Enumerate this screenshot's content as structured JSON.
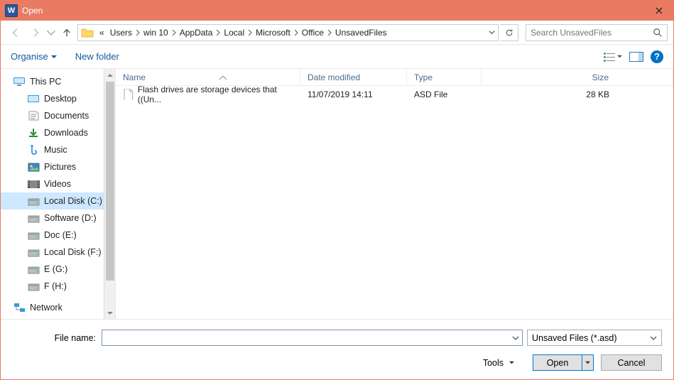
{
  "titlebar": {
    "title": "Open",
    "app_glyph": "W"
  },
  "nav": {
    "breadcrumb_prefix": "«",
    "crumbs": [
      "Users",
      "win 10",
      "AppData",
      "Local",
      "Microsoft",
      "Office",
      "UnsavedFiles"
    ],
    "search_placeholder": "Search UnsavedFiles"
  },
  "toolbar": {
    "organise": "Organise",
    "new_folder": "New folder"
  },
  "tree": {
    "top": {
      "label": "This PC",
      "children": [
        "Desktop",
        "Documents",
        "Downloads",
        "Music",
        "Pictures",
        "Videos",
        "Local Disk (C:)",
        "Software (D:)",
        "Doc (E:)",
        "Local Disk (F:)",
        "E (G:)",
        "F (H:)"
      ],
      "selected_index": 6
    },
    "bottom": {
      "label": "Network"
    }
  },
  "columns": {
    "name": "Name",
    "date": "Date modified",
    "type": "Type",
    "size": "Size"
  },
  "rows": [
    {
      "name": "Flash drives are storage devices that ((Un...",
      "date": "11/07/2019 14:11",
      "type": "ASD File",
      "size": "28 KB"
    }
  ],
  "footer": {
    "filename_label": "File name:",
    "filter": "Unsaved Files (*.asd)",
    "tools": "Tools",
    "open": "Open",
    "cancel": "Cancel"
  },
  "colors": {
    "accent": "#e97b63",
    "link": "#125a9c"
  }
}
